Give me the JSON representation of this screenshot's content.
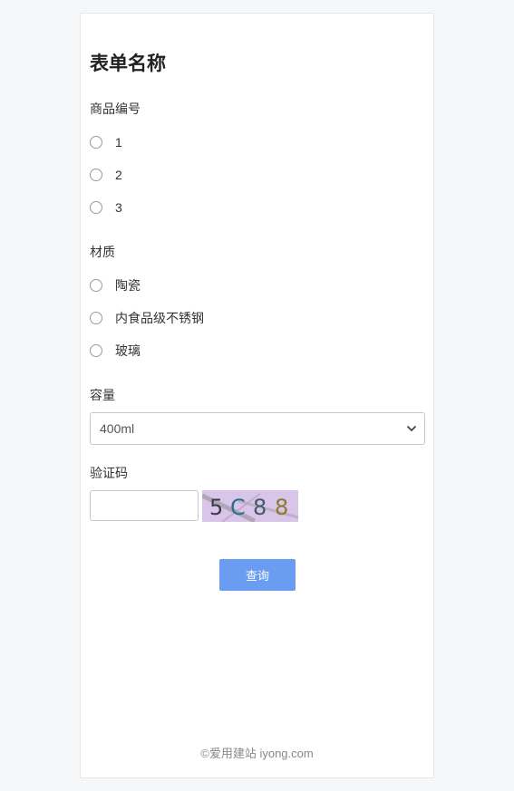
{
  "form": {
    "title": "表单名称",
    "product_field": {
      "label": "商品编号",
      "options": [
        "1",
        "2",
        "3"
      ]
    },
    "material_field": {
      "label": "材质",
      "options": [
        "陶瓷",
        "内食品级不锈钢",
        "玻璃"
      ]
    },
    "capacity_field": {
      "label": "容量",
      "selected": "400ml"
    },
    "captcha_field": {
      "label": "验证码",
      "input_value": "",
      "image_text": "5C88",
      "chars": [
        "5",
        "C",
        "8",
        "8"
      ]
    },
    "submit_label": "查询"
  },
  "footer": {
    "text": "©爱用建站 iyong.com"
  },
  "icons": {
    "select_arrow": "chevron-down-icon"
  },
  "colors": {
    "page_background": "#f6f7f8",
    "card_background": "#ffffff",
    "button_primary": "#6a9cf2",
    "captcha_background": "#d9c4ea"
  }
}
